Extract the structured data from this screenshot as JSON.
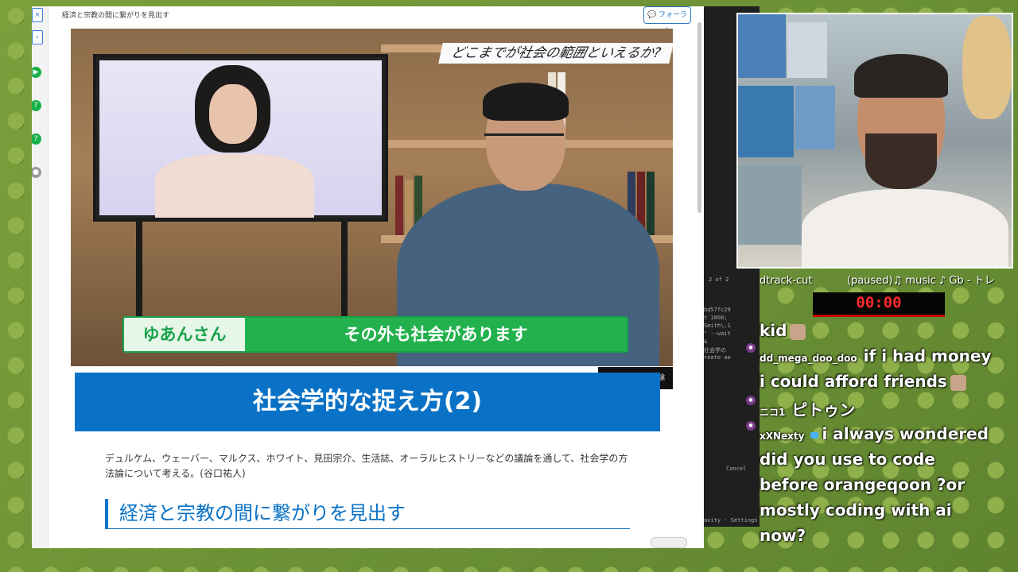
{
  "page": {
    "breadcrumb": "経済と宗教の間に繋がりを見出す",
    "forum_button": "フォーラム",
    "video": {
      "topic_banner": "どこまでが社会の範囲といえるか?",
      "speaker_name": "ゆあんさん",
      "caption": "その外も社会があります",
      "theater_button": "シアター解除"
    },
    "lesson_title": "社会学的な捉え方(2)",
    "description": "デュルケム、ウェーバー、マルクス、ホワイト、見田宗介、生活誌、オーラルヒストリーなどの議論を通して、社会学の方法論について考える。(谷口祐人)",
    "section_heading": "経済と宗教の間に繋がりを見出す"
  },
  "stream": {
    "overlay_left": "dtrack-cut",
    "overlay_right": "(paused)♫ music ♪ Gb - トレ",
    "timer": "00:00",
    "chat": [
      {
        "user": "",
        "text": "kid"
      },
      {
        "user": "dd_mega_doo_doo",
        "text": "if i had money"
      },
      {
        "user": "",
        "text": "i could afford friends"
      },
      {
        "user": "ニコ1",
        "text": "ピトゥン"
      },
      {
        "user": "xXNexty",
        "text": "i always wondered"
      },
      {
        "user": "",
        "text": "did you use to code"
      },
      {
        "user": "",
        "text": "before orangeqoon ?or"
      },
      {
        "user": "",
        "text": "mostly coding with ai"
      },
      {
        "user": "",
        "text": "now?"
      }
    ]
  },
  "ide": {
    "tab_label": "2 of 2",
    "lines": [
      "bd57fc29",
      "t 1800;",
      "Smith\\.1",
      "\" --wait",
      "&",
      "社会学の",
      "reate ae"
    ],
    "cancel_label": "Cancel",
    "status": "avity - Settings"
  },
  "icons": {
    "rail": [
      "close-icon",
      "chevron-right-icon",
      "play-icon",
      "help-icon",
      "help-icon",
      "circle-icon"
    ]
  }
}
